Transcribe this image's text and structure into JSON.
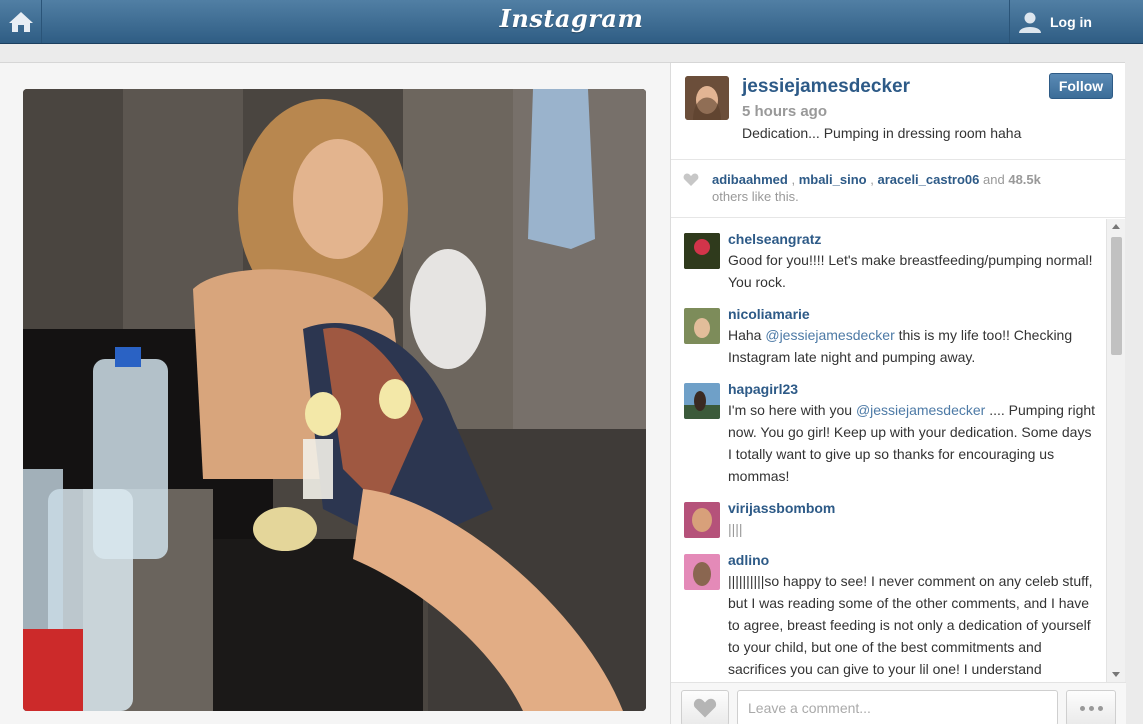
{
  "header": {
    "brand": "Instagram",
    "login_label": "Log in"
  },
  "post": {
    "username": "jessiejamesdecker",
    "time_ago": "5 hours ago",
    "caption": "Dedication... Pumping in dressing room haha",
    "follow_label": "Follow"
  },
  "likes": {
    "users": [
      "adibaahmed",
      "mbali_sino",
      "araceli_castro06"
    ],
    "and_label": "and",
    "count": "48.5k",
    "suffix": "others like this."
  },
  "comments": [
    {
      "user": "chelseangratz",
      "text": "Good for you!!!! Let's make breastfeeding/pumping normal! You rock.",
      "mention": ""
    },
    {
      "user": "nicoliamarie",
      "prefix": "Haha ",
      "mention": "@jessiejamesdecker",
      "text": " this is my life too!! Checking Instagram late night and pumping away."
    },
    {
      "user": "hapagirl23",
      "prefix": "I'm so here with you ",
      "mention": "@jessiejamesdecker",
      "text": " .... Pumping right now. You go girl! Keep up with your dedication. Some days I totally want to give up so thanks for encouraging us mommas!"
    },
    {
      "user": "virijassbombom",
      "text": "||||",
      "mention": ""
    },
    {
      "user": "adlino",
      "text": "||||||||||so happy to see! I never comment on any celeb stuff, but I was reading some of the other comments, and I have to agree, breast feeding is not only a dedication of yourself to your child, but one of the best commitments and sacrifices you can give to your lil one! I understand",
      "mention": ""
    }
  ],
  "footer": {
    "comment_placeholder": "Leave a comment..."
  },
  "colors": {
    "topbar": "#3d6a93",
    "username": "#2d5a87",
    "follow": "#4a7aa7"
  }
}
